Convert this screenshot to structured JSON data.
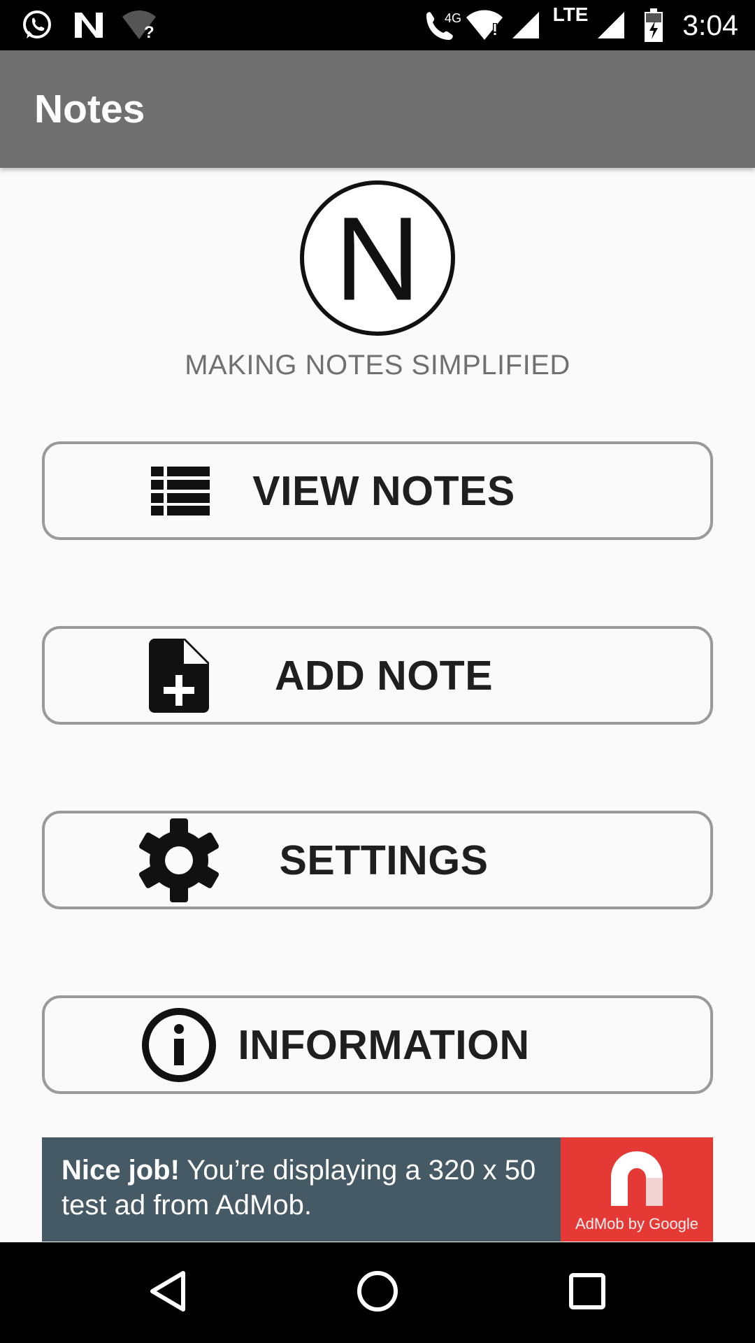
{
  "status_bar": {
    "time": "3:04",
    "icons": [
      "whatsapp-icon",
      "notes-n-icon",
      "wifi-unknown-icon",
      "wifi-call-icon",
      "wifi-alert-icon",
      "signal-icon",
      "lte-signal-icon",
      "battery-charging-icon"
    ],
    "network_4g": "4G",
    "network_lte": "LTE"
  },
  "app_bar": {
    "title": "Notes"
  },
  "header": {
    "logo_letter": "N",
    "tagline": "MAKING NOTES SIMPLIFIED"
  },
  "menu": [
    {
      "label": "VIEW NOTES",
      "icon": "list-icon"
    },
    {
      "label": "ADD NOTE",
      "icon": "note-add-icon"
    },
    {
      "label": "SETTINGS",
      "icon": "gear-icon"
    },
    {
      "label": "INFORMATION",
      "icon": "info-icon"
    }
  ],
  "ad": {
    "headline": "Nice job!",
    "body": " You’re displaying a 320 x 50 test ad from AdMob.",
    "brand": "AdMob by Google",
    "background": "#455a64",
    "brand_color": "#e53935"
  },
  "nav_bar": {
    "buttons": [
      "back-icon",
      "home-icon",
      "recents-icon"
    ]
  },
  "colors": {
    "app_bar": "#707070",
    "background": "#fafafa",
    "button_border": "#9a9a9a",
    "text_dark": "#1f1f1f"
  }
}
